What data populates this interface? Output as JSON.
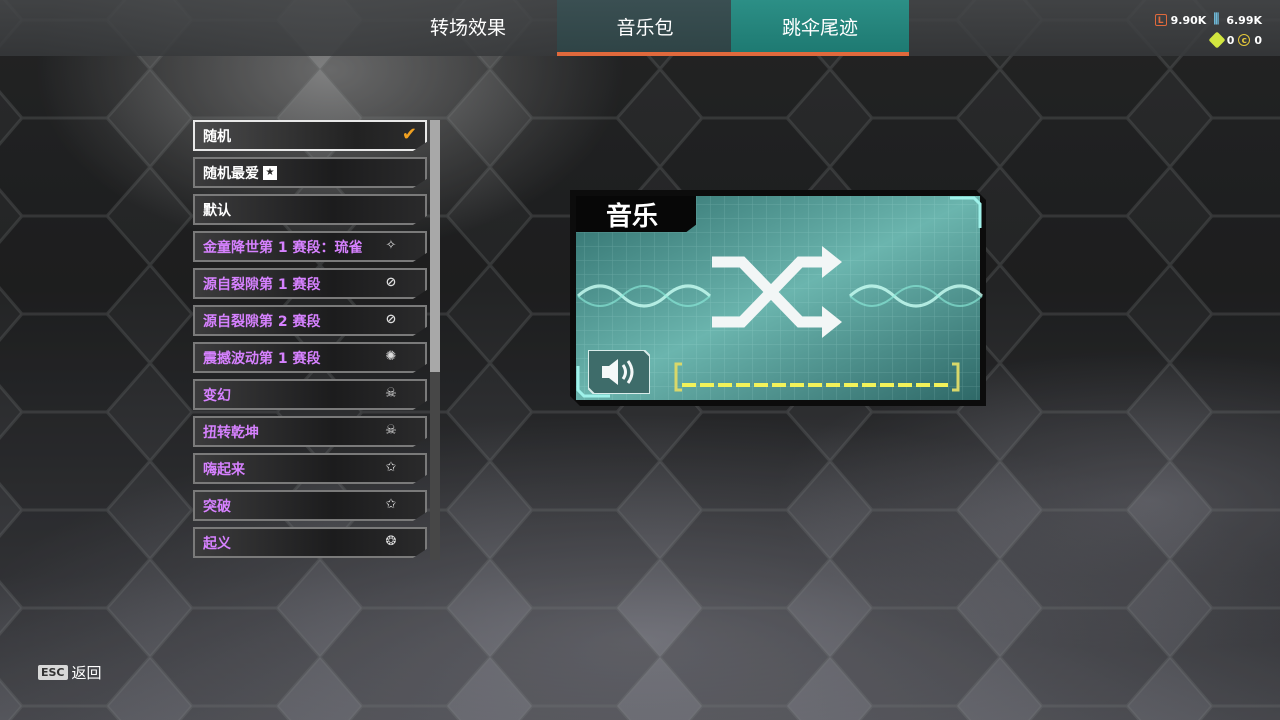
{
  "tabs": [
    {
      "label": "转场效果"
    },
    {
      "label": "音乐包"
    },
    {
      "label": "跳伞尾迹"
    }
  ],
  "currency": {
    "legend_tokens": "9.90K",
    "crafting_metals": "6.99K",
    "gems": "0",
    "coins": "0"
  },
  "list": {
    "items": [
      {
        "label": "随机",
        "selected": true
      },
      {
        "label": "随机最爱"
      },
      {
        "label": "默认"
      },
      {
        "label": "金童降世第 1 赛段：琉雀",
        "icon": "fairy-badge-icon"
      },
      {
        "label": "源自裂隙第 1 赛段",
        "icon": "rift-badge-icon"
      },
      {
        "label": "源自裂隙第 2 赛段",
        "icon": "rift-badge-icon"
      },
      {
        "label": "震撼波动第 1 赛段",
        "icon": "shockwave-badge-icon"
      },
      {
        "label": "变幻",
        "icon": "skull-badge-icon"
      },
      {
        "label": "扭转乾坤",
        "icon": "skull-badge-icon"
      },
      {
        "label": "嗨起来",
        "icon": "star-badge-icon"
      },
      {
        "label": "突破",
        "icon": "star-badge-icon"
      },
      {
        "label": "起义",
        "icon": "claw-badge-icon"
      }
    ]
  },
  "preview": {
    "title": "音乐",
    "volume_level": 1.0
  },
  "footer": {
    "esc_key": "ESC",
    "back_label": "返回"
  },
  "colors": {
    "accent_orange": "#e0693c",
    "active_tab_teal": "#2c8f86",
    "purple_text": "#d681ff",
    "check_orange": "#f0a020",
    "volume_yellow": "#f2f25a"
  }
}
